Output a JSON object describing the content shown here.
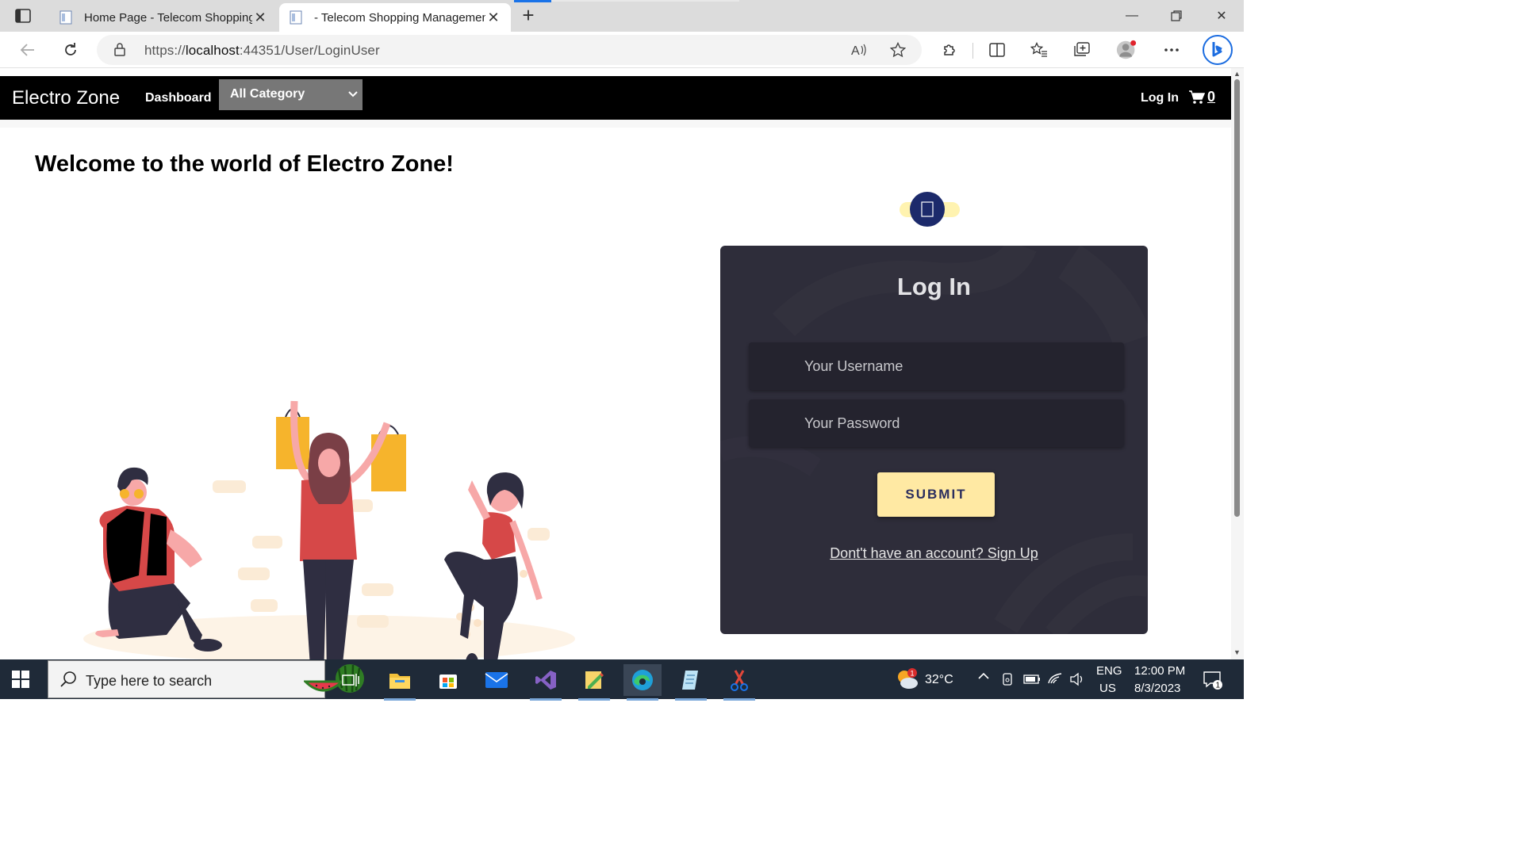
{
  "browser": {
    "tabs": [
      {
        "title": "Home Page - Telecom Shopping",
        "active": false
      },
      {
        "title": "- Telecom Shopping Managemen",
        "active": true
      }
    ],
    "url_host": "localhost",
    "url_prefix": "https://",
    "url_rest": ":44351/User/LoginUser"
  },
  "navbar": {
    "brand": "Electro Zone",
    "dashboard": "Dashboard",
    "category_selected": "All Category",
    "login": "Log In",
    "cart_count": "0"
  },
  "main": {
    "welcome": "Welcome to the world of Electro Zone!"
  },
  "login_card": {
    "title": "Log In",
    "username_placeholder": "Your Username",
    "password_placeholder": "Your Password",
    "submit_label": "SUBMIT",
    "signup_text": "Dont't have an account? Sign Up"
  },
  "taskbar": {
    "search_placeholder": "Type here to search",
    "weather_temp": "32°C",
    "weather_badge": "1",
    "lang_top": "ENG",
    "lang_bottom": "US",
    "time": "12:00 PM",
    "date": "8/3/2023",
    "notif_count": "1"
  },
  "colors": {
    "navbar_bg": "#000000",
    "card_bg": "#2e2d3a",
    "submit_bg": "#ffe9a3",
    "badge_blue": "#1c2a6b",
    "accent_yellow": "#f6b42c",
    "accent_red": "#d64848"
  }
}
